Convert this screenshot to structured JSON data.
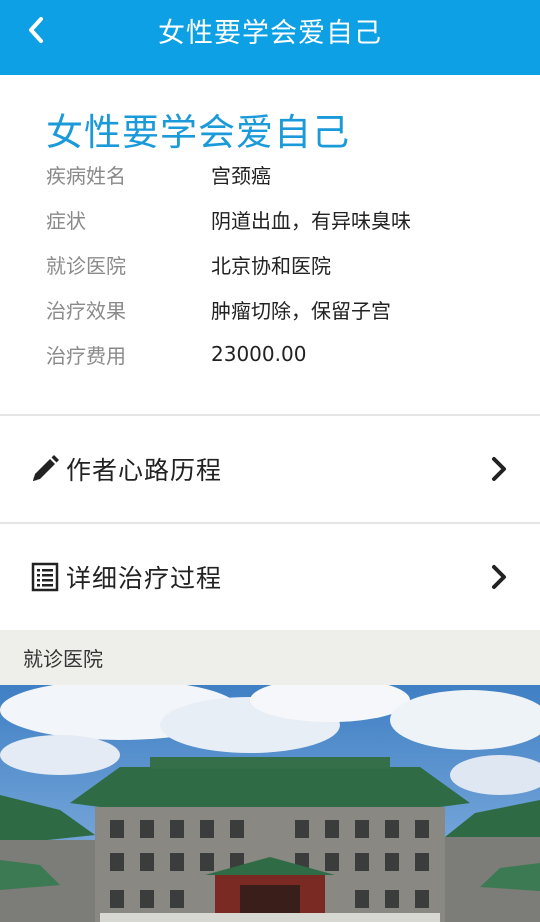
{
  "header": {
    "back_icon": "chevron-left-icon",
    "title": "女性要学会爱自己"
  },
  "case": {
    "headline": "女性要学会爱自己",
    "fields": [
      {
        "key": "疾病姓名",
        "value": "宫颈癌"
      },
      {
        "key": "症状",
        "value": "阴道出血，有异味臭味"
      },
      {
        "key": "就诊医院",
        "value": "北京协和医院"
      },
      {
        "key": "治疗效果",
        "value": "肿瘤切除，保留子宫"
      },
      {
        "key": "治疗费用",
        "value": "23000.00"
      }
    ]
  },
  "links": [
    {
      "icon": "pencil-icon",
      "label": "作者心路历程"
    },
    {
      "icon": "list-document-icon",
      "label": "详细治疗过程"
    }
  ],
  "hospital_section": {
    "title": "就诊医院",
    "photo": "hospital-building-photo"
  },
  "colors": {
    "accent": "#0da0e4",
    "headline": "#1a9ad9",
    "label_gray": "#8a8a8a",
    "section_bg": "#eeeeea"
  }
}
